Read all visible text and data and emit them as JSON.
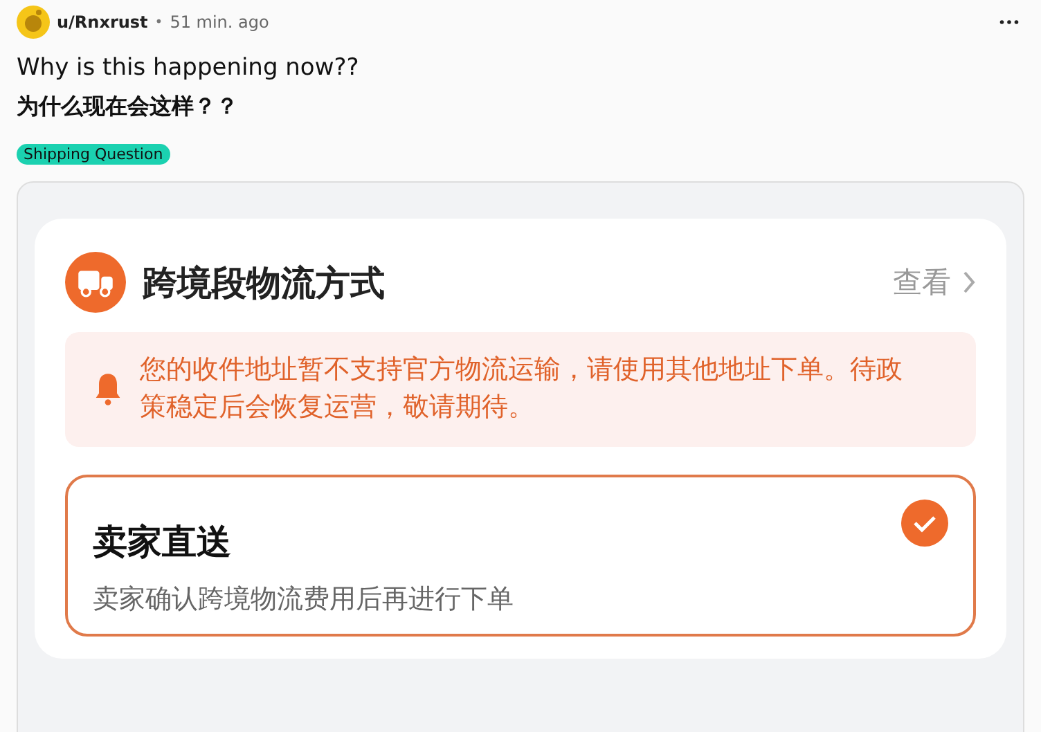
{
  "post": {
    "author": "u/Rnxrust",
    "separator": "•",
    "time": "51 min. ago",
    "title": "Why is this happening now??",
    "body": "为什么现在会这样？？",
    "flair": "Shipping Question"
  },
  "screenshot": {
    "section_title": "跨境段物流方式",
    "view_link": "查看",
    "notice": "您的收件地址暂不支持官方物流运输，请使用其他地址下单。待政策稳定后会恢复运营，敬请期待。",
    "options": [
      {
        "title": "卖家直送",
        "description": "卖家确认跨境物流费用后再进行下单",
        "selected": true
      }
    ]
  }
}
